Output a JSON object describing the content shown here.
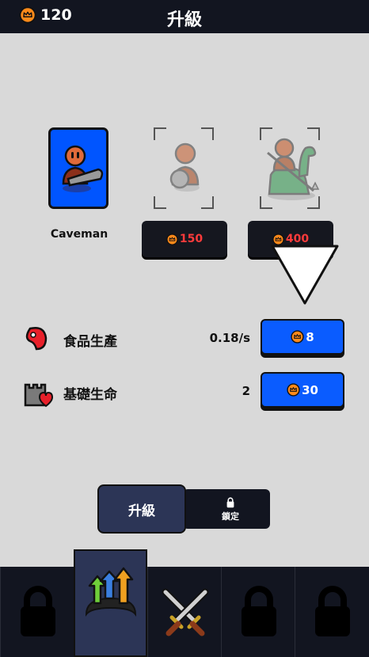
{
  "header": {
    "currency_value": "120",
    "title": "升級"
  },
  "units": [
    {
      "name": "Caveman",
      "state": "selected"
    },
    {
      "cost": "150",
      "state": "locked"
    },
    {
      "cost": "400",
      "state": "locked"
    }
  ],
  "stats": [
    {
      "label": "食品生產",
      "value": "0.18/s",
      "upgrade_cost": "8",
      "icon": "meat-icon"
    },
    {
      "label": "基礎生命",
      "value": "2",
      "upgrade_cost": "30",
      "icon": "castle-heart-icon"
    }
  ],
  "toggle": {
    "upgrade_label": "升級",
    "locked_label": "鎖定"
  },
  "nav": [
    {
      "icon": "lock-icon",
      "state": "locked"
    },
    {
      "icon": "upgrade-arrows-icon",
      "state": "active"
    },
    {
      "icon": "crossed-swords-icon",
      "state": "available"
    },
    {
      "icon": "lock-icon",
      "state": "locked"
    },
    {
      "icon": "lock-icon",
      "state": "locked"
    }
  ],
  "colors": {
    "accent_blue": "#0a5cff",
    "cost_red": "#ff3b3b",
    "dark": "#121520",
    "coin": "#ff8a1a",
    "active_nav": "#2c3556"
  }
}
